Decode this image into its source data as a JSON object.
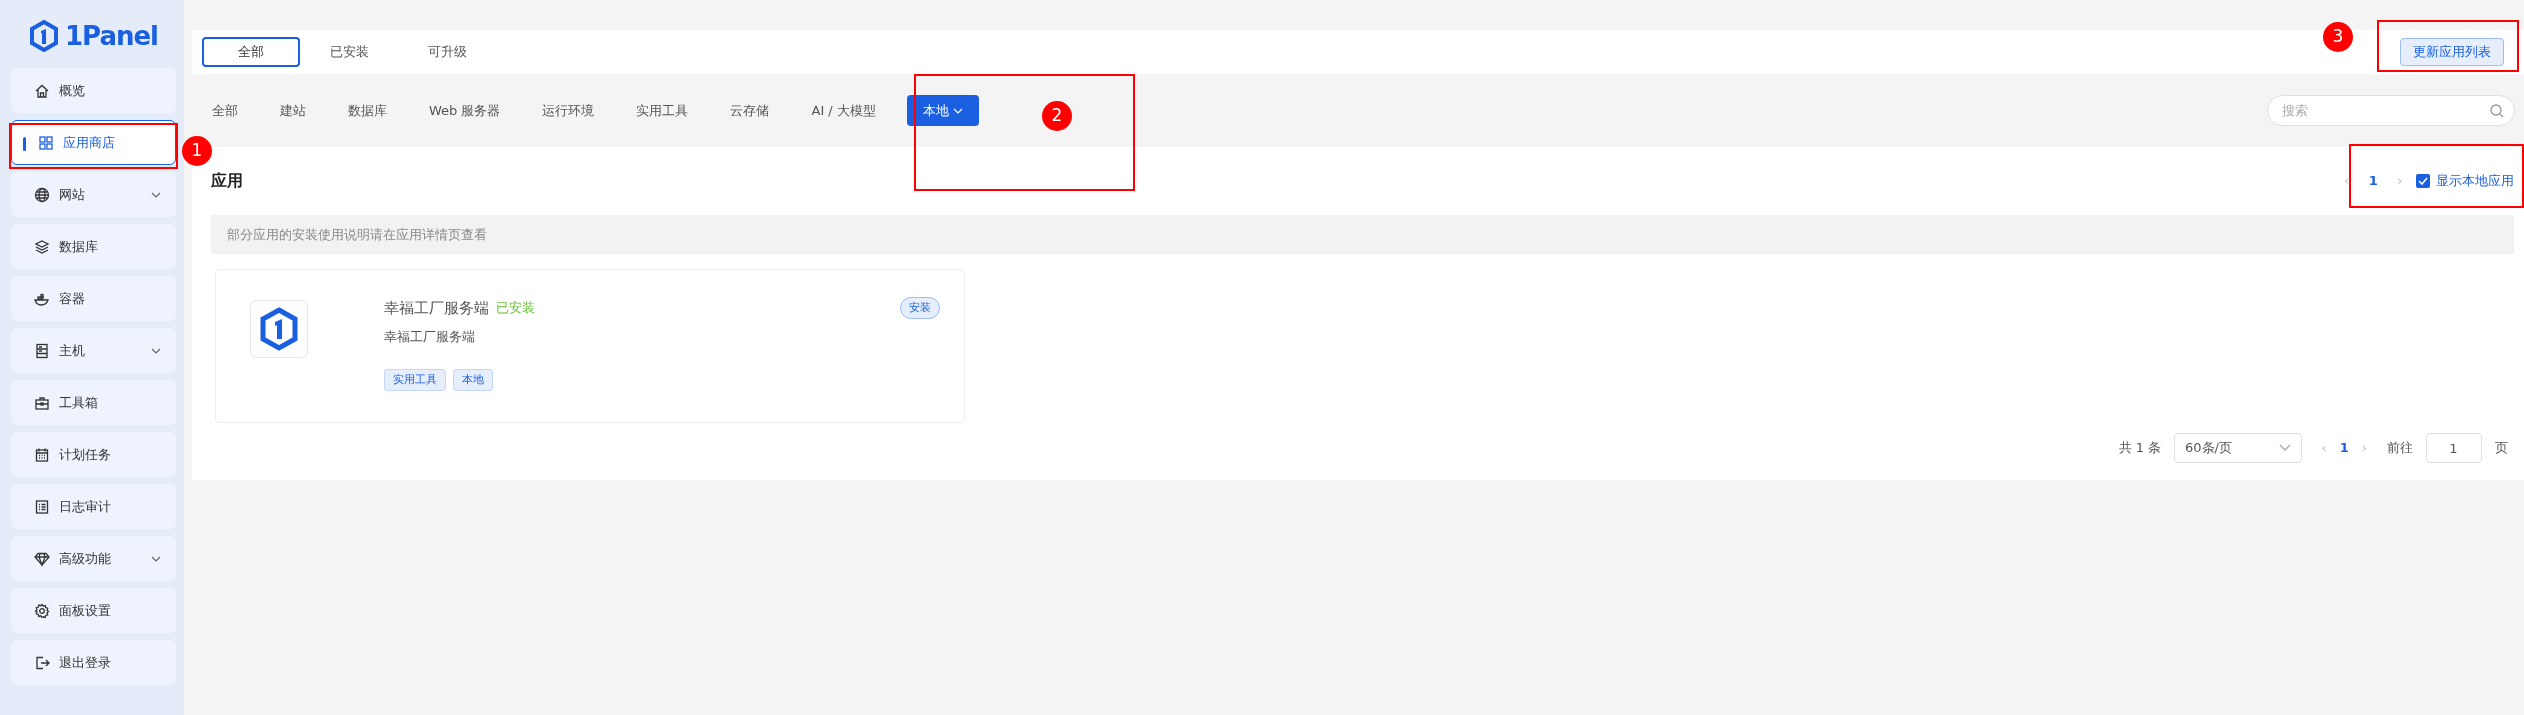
{
  "sidebar": {
    "logo": "1Panel",
    "items": [
      {
        "label": "概览",
        "selected": false,
        "expandable": false
      },
      {
        "label": "应用商店",
        "selected": true,
        "expandable": false
      },
      {
        "label": "网站",
        "selected": false,
        "expandable": true
      },
      {
        "label": "数据库",
        "selected": false,
        "expandable": false
      },
      {
        "label": "容器",
        "selected": false,
        "expandable": false
      },
      {
        "label": "主机",
        "selected": false,
        "expandable": true
      },
      {
        "label": "工具箱",
        "selected": false,
        "expandable": false
      },
      {
        "label": "计划任务",
        "selected": false,
        "expandable": false
      },
      {
        "label": "日志审计",
        "selected": false,
        "expandable": false
      },
      {
        "label": "高级功能",
        "selected": false,
        "expandable": true
      },
      {
        "label": "面板设置",
        "selected": false,
        "expandable": false
      },
      {
        "label": "退出登录",
        "selected": false,
        "expandable": false
      }
    ]
  },
  "tabs": [
    {
      "label": "全部",
      "selected": true
    },
    {
      "label": "已安装",
      "selected": false
    },
    {
      "label": "可升级",
      "selected": false
    }
  ],
  "update_button": "更新应用列表",
  "categories": [
    {
      "label": "全部",
      "selected": false,
      "dropdown": false
    },
    {
      "label": "建站",
      "selected": false,
      "dropdown": false
    },
    {
      "label": "数据库",
      "selected": false,
      "dropdown": false
    },
    {
      "label": "Web 服务器",
      "selected": false,
      "dropdown": false
    },
    {
      "label": "运行环境",
      "selected": false,
      "dropdown": false
    },
    {
      "label": "实用工具",
      "selected": false,
      "dropdown": false
    },
    {
      "label": "云存储",
      "selected": false,
      "dropdown": false
    },
    {
      "label": "AI / 大模型",
      "selected": false,
      "dropdown": false
    },
    {
      "label": "本地",
      "selected": true,
      "dropdown": true
    }
  ],
  "search": {
    "placeholder": "搜索"
  },
  "section": {
    "title": "应用",
    "mini_pager": {
      "prev": "‹",
      "page": "1",
      "next": "›"
    },
    "show_local": {
      "label": "显示本地应用",
      "checked": true
    },
    "notice": "部分应用的安装使用说明请在应用详情页查看"
  },
  "apps": [
    {
      "name": "幸福工厂服务端",
      "status": "已安装",
      "description": "幸福工厂服务端",
      "install_button": "安装",
      "tags": [
        "实用工具",
        "本地"
      ]
    }
  ],
  "pagination": {
    "total": "共 1 条",
    "page_size": "60条/页",
    "prev": "‹",
    "page": "1",
    "next": "›",
    "goto_label": "前往",
    "goto_value": "1",
    "page_suffix": "页"
  },
  "annotations": [
    {
      "kind": "numbered",
      "number": "1"
    },
    {
      "kind": "numbered",
      "number": "2"
    },
    {
      "kind": "numbered",
      "number": "3"
    },
    {
      "kind": "box"
    }
  ]
}
